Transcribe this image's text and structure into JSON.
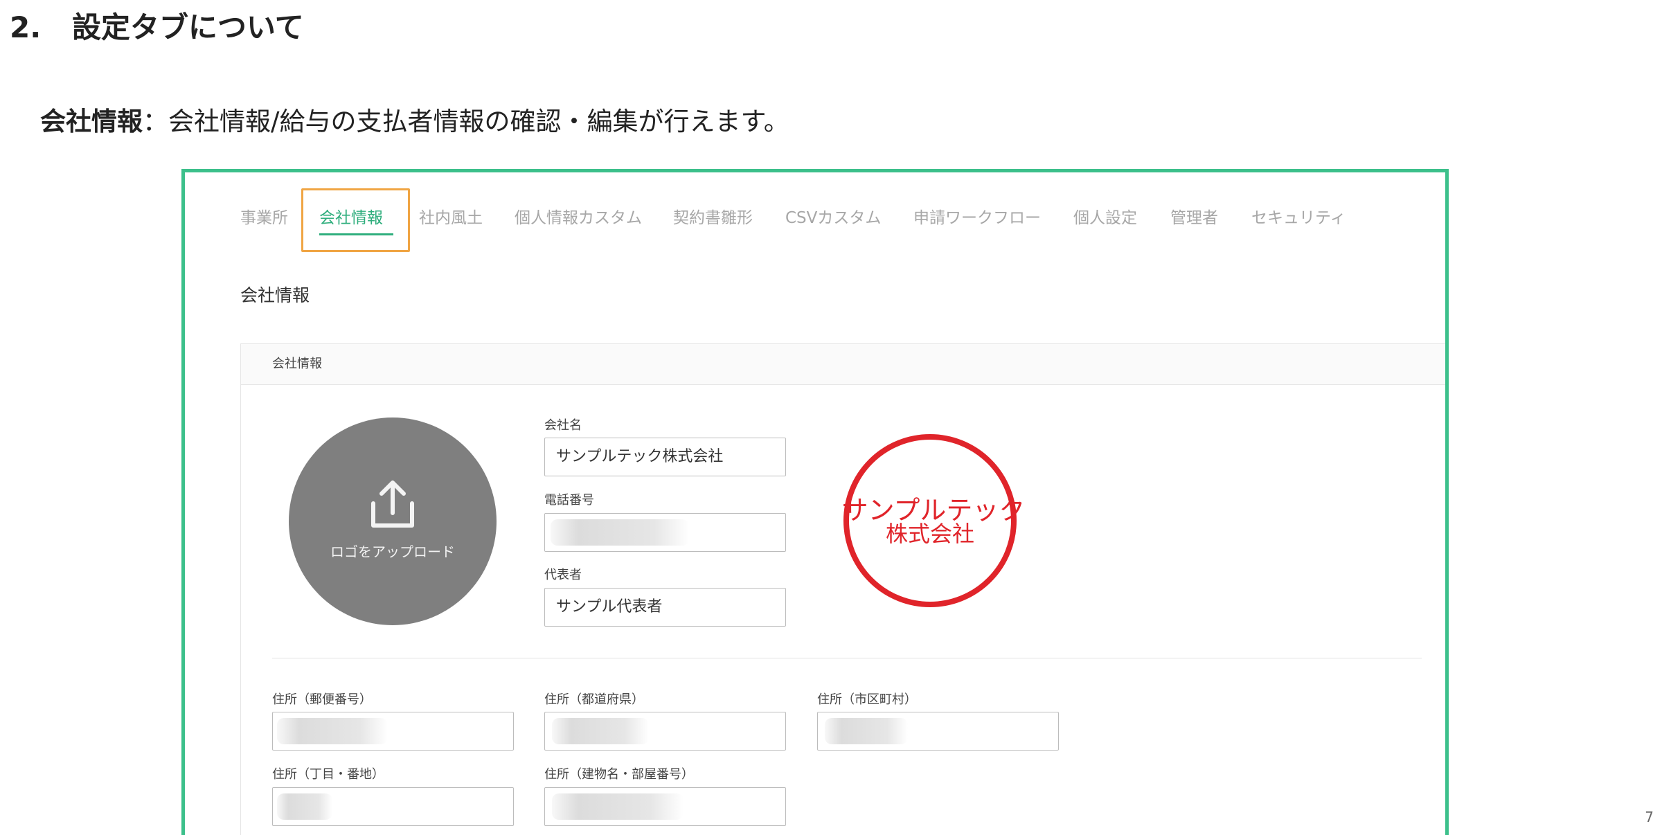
{
  "heading": {
    "number": "2.",
    "title": "設定タブについて"
  },
  "intro": {
    "label": "会社情報",
    "separator": "：",
    "description": "会社情報/給与の支払者情報の確認・編集が行えます。"
  },
  "tabs": [
    {
      "label": "事業所"
    },
    {
      "label": "会社情報",
      "active": true
    },
    {
      "label": "社内風土"
    },
    {
      "label": "個人情報カスタム"
    },
    {
      "label": "契約書雛形"
    },
    {
      "label": "CSVカスタム"
    },
    {
      "label": "申請ワークフロー"
    },
    {
      "label": "個人設定"
    },
    {
      "label": "管理者"
    },
    {
      "label": "セキュリティ"
    }
  ],
  "page_title": "会社情報",
  "panel": {
    "header": "会社情報",
    "logo_upload": {
      "label": "ロゴをアップロード",
      "icon": "upload-icon"
    },
    "seal": {
      "line1": "サンプルテック",
      "line2": "株式会社",
      "color": "#e0242a"
    },
    "fields": {
      "company_name": {
        "label": "会社名",
        "value": "サンプルテック株式会社"
      },
      "phone": {
        "label": "電話番号",
        "value": ""
      },
      "representative": {
        "label": "代表者",
        "value": "サンプル代表者"
      },
      "postal_code": {
        "label": "住所（郵便番号）",
        "value": ""
      },
      "prefecture": {
        "label": "住所（都道府県）",
        "value": ""
      },
      "city": {
        "label": "住所（市区町村）",
        "value": ""
      },
      "street": {
        "label": "住所（丁目・番地）",
        "value": ""
      },
      "building": {
        "label": "住所（建物名・部屋番号）",
        "value": ""
      }
    }
  },
  "colors": {
    "frame": "#3cc08b",
    "active_tab": "#2fae7d",
    "highlight_box": "#f0a544"
  },
  "page_number": "7"
}
